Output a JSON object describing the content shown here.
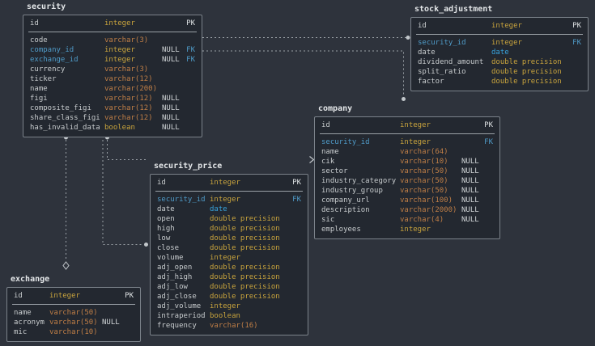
{
  "diagram": {
    "tables": [
      {
        "name": "security",
        "columns": [
          {
            "name": "id",
            "type": "integer",
            "nullable": "",
            "key": "PK"
          },
          {
            "name": "code",
            "type": "varchar(3)",
            "nullable": "",
            "key": ""
          },
          {
            "name": "company_id",
            "type": "integer",
            "nullable": "NULL",
            "key": "FK"
          },
          {
            "name": "exchange_id",
            "type": "integer",
            "nullable": "NULL",
            "key": "FK"
          },
          {
            "name": "currency",
            "type": "varchar(3)",
            "nullable": "",
            "key": ""
          },
          {
            "name": "ticker",
            "type": "varchar(12)",
            "nullable": "",
            "key": ""
          },
          {
            "name": "name",
            "type": "varchar(200)",
            "nullable": "",
            "key": ""
          },
          {
            "name": "figi",
            "type": "varchar(12)",
            "nullable": "NULL",
            "key": ""
          },
          {
            "name": "composite_figi",
            "type": "varchar(12)",
            "nullable": "NULL",
            "key": ""
          },
          {
            "name": "share_class_figi",
            "type": "varchar(12)",
            "nullable": "NULL",
            "key": ""
          },
          {
            "name": "has_invalid_data",
            "type": "boolean",
            "nullable": "NULL",
            "key": ""
          }
        ]
      },
      {
        "name": "stock_adjustment",
        "columns": [
          {
            "name": "id",
            "type": "integer",
            "nullable": "",
            "key": "PK"
          },
          {
            "name": "security_id",
            "type": "integer",
            "nullable": "",
            "key": "FK"
          },
          {
            "name": "date",
            "type": "date",
            "nullable": "",
            "key": ""
          },
          {
            "name": "dividend_amount",
            "type": "double precision",
            "nullable": "",
            "key": ""
          },
          {
            "name": "split_ratio",
            "type": "double precision",
            "nullable": "",
            "key": ""
          },
          {
            "name": "factor",
            "type": "double precision",
            "nullable": "",
            "key": ""
          }
        ]
      },
      {
        "name": "company",
        "columns": [
          {
            "name": "id",
            "type": "integer",
            "nullable": "",
            "key": "PK"
          },
          {
            "name": "security_id",
            "type": "integer",
            "nullable": "",
            "key": "FK"
          },
          {
            "name": "name",
            "type": "varchar(64)",
            "nullable": "",
            "key": ""
          },
          {
            "name": "cik",
            "type": "varchar(10)",
            "nullable": "NULL",
            "key": ""
          },
          {
            "name": "sector",
            "type": "varchar(50)",
            "nullable": "NULL",
            "key": ""
          },
          {
            "name": "industry_category",
            "type": "varchar(50)",
            "nullable": "NULL",
            "key": ""
          },
          {
            "name": "industry_group",
            "type": "varchar(50)",
            "nullable": "NULL",
            "key": ""
          },
          {
            "name": "company_url",
            "type": "varchar(100)",
            "nullable": "NULL",
            "key": ""
          },
          {
            "name": "description",
            "type": "varchar(2000)",
            "nullable": "NULL",
            "key": ""
          },
          {
            "name": "sic",
            "type": "varchar(4)",
            "nullable": "NULL",
            "key": ""
          },
          {
            "name": "employees",
            "type": "integer",
            "nullable": "",
            "key": ""
          }
        ]
      },
      {
        "name": "security_price",
        "columns": [
          {
            "name": "id",
            "type": "integer",
            "nullable": "",
            "key": "PK"
          },
          {
            "name": "security_id",
            "type": "integer",
            "nullable": "",
            "key": "FK"
          },
          {
            "name": "date",
            "type": "date",
            "nullable": "",
            "key": ""
          },
          {
            "name": "open",
            "type": "double precision",
            "nullable": "",
            "key": ""
          },
          {
            "name": "high",
            "type": "double precision",
            "nullable": "",
            "key": ""
          },
          {
            "name": "low",
            "type": "double precision",
            "nullable": "",
            "key": ""
          },
          {
            "name": "close",
            "type": "double precision",
            "nullable": "",
            "key": ""
          },
          {
            "name": "volume",
            "type": "integer",
            "nullable": "",
            "key": ""
          },
          {
            "name": "adj_open",
            "type": "double precision",
            "nullable": "",
            "key": ""
          },
          {
            "name": "adj_high",
            "type": "double precision",
            "nullable": "",
            "key": ""
          },
          {
            "name": "adj_low",
            "type": "double precision",
            "nullable": "",
            "key": ""
          },
          {
            "name": "adj_close",
            "type": "double precision",
            "nullable": "",
            "key": ""
          },
          {
            "name": "adj_volume",
            "type": "integer",
            "nullable": "",
            "key": ""
          },
          {
            "name": "intraperiod",
            "type": "boolean",
            "nullable": "",
            "key": ""
          },
          {
            "name": "frequency",
            "type": "varchar(16)",
            "nullable": "",
            "key": ""
          }
        ]
      },
      {
        "name": "exchange",
        "columns": [
          {
            "name": "id",
            "type": "integer",
            "nullable": "",
            "key": "PK"
          },
          {
            "name": "name",
            "type": "varchar(50)",
            "nullable": "",
            "key": ""
          },
          {
            "name": "acronym",
            "type": "varchar(50)",
            "nullable": "NULL",
            "key": ""
          },
          {
            "name": "mic",
            "type": "varchar(10)",
            "nullable": "",
            "key": ""
          }
        ]
      }
    ],
    "relationships": [
      {
        "from": "stock_adjustment.security_id",
        "to": "security.id"
      },
      {
        "from": "security.company_id",
        "to": "company.id"
      },
      {
        "from": "security_price.security_id",
        "to": "security.id"
      },
      {
        "from": "company.security_id",
        "to": "security.id"
      },
      {
        "from": "security.exchange_id",
        "to": "exchange.id"
      }
    ],
    "colors": {
      "canvas": "#2e333c",
      "table_fill": "#232830",
      "table_border": "#7b828a",
      "title_text": "#e3e6e8",
      "column_text": "#c7cbcd",
      "fk_text": "#4f9bc8",
      "type_numeric": "#c9a43d",
      "type_varchar": "#bf7e46",
      "type_date": "#38a3dc",
      "null_text": "#d3d7d9",
      "pk_text": "#dfe3e5",
      "edge": "#9aa0a6",
      "marker": "#c2c7cb"
    }
  }
}
